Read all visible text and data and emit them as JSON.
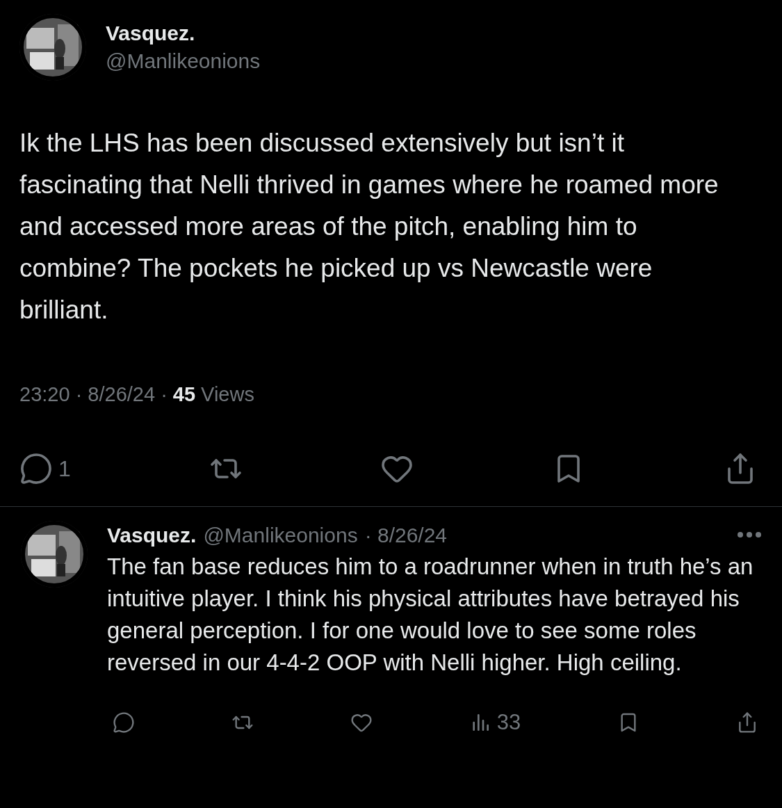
{
  "tweet": {
    "author": {
      "name": "Vasquez.",
      "handle": "@Manlikeonions"
    },
    "text": "Ik the LHS has been discussed extensively but isn’t it fascinating that Nelli thrived in games where he roamed more and accessed more areas of the pitch, enabling him to combine? The pockets he picked up vs Newcastle were brilliant.",
    "meta": "23:20 · 8/26/24 ·",
    "views_count": "45",
    "views_label": "Views",
    "actions": [
      {
        "kind": "reply",
        "count": "1"
      },
      {
        "kind": "repost"
      },
      {
        "kind": "like"
      },
      {
        "kind": "bookmark"
      },
      {
        "kind": "share"
      }
    ]
  },
  "reply": {
    "author": {
      "name": "Vasquez.",
      "handle": "@Manlikeonions"
    },
    "date": "· 8/26/24",
    "text": "The fan base reduces him to a roadrunner when in truth he’s an intuitive player. I think his physical attributes have betrayed his general perception. I for one would love to see some roles reversed in our 4-4-2 OOP with Nelli higher. High ceiling.",
    "actions": [
      {
        "kind": "reply"
      },
      {
        "kind": "repost"
      },
      {
        "kind": "like"
      },
      {
        "kind": "views",
        "count": "33"
      },
      {
        "kind": "bookmark"
      },
      {
        "kind": "share"
      }
    ]
  }
}
